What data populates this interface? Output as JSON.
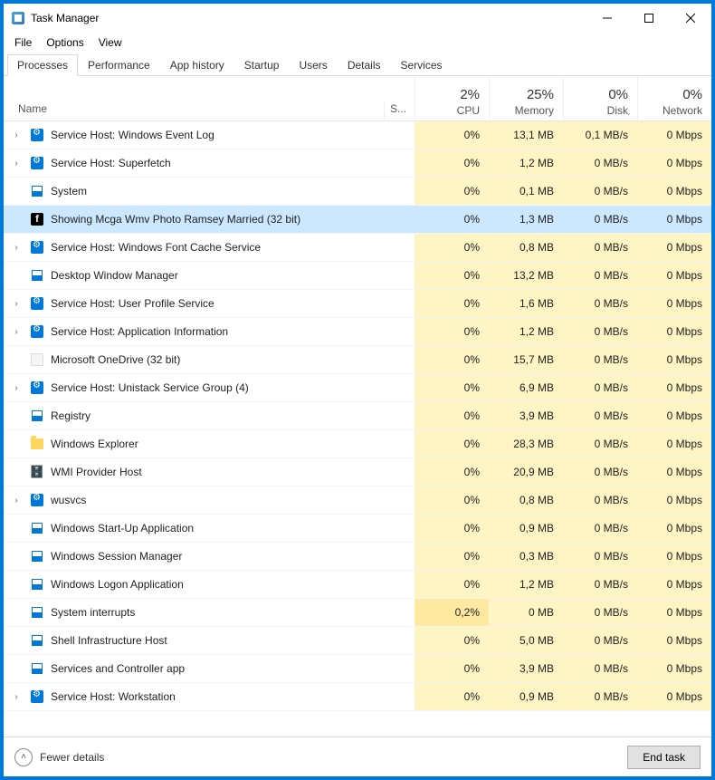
{
  "window": {
    "title": "Task Manager"
  },
  "menu": {
    "file": "File",
    "options": "Options",
    "view": "View"
  },
  "tabs": {
    "processes": "Processes",
    "performance": "Performance",
    "app_history": "App history",
    "startup": "Startup",
    "users": "Users",
    "details": "Details",
    "services": "Services"
  },
  "columns": {
    "name": "Name",
    "status": "S...",
    "cpu_pct": "2%",
    "cpu_lbl": "CPU",
    "mem_pct": "25%",
    "mem_lbl": "Memory",
    "disk_pct": "0%",
    "disk_lbl": "Disk",
    "net_pct": "0%",
    "net_lbl": "Network"
  },
  "processes": [
    {
      "expand": true,
      "icon": "gear",
      "name": "Service Host: Windows Event Log",
      "cpu": "0%",
      "mem": "13,1 MB",
      "disk": "0,1 MB/s",
      "net": "0 Mbps",
      "selected": false
    },
    {
      "expand": true,
      "icon": "gear",
      "name": "Service Host: Superfetch",
      "cpu": "0%",
      "mem": "1,2 MB",
      "disk": "0 MB/s",
      "net": "0 Mbps",
      "selected": false
    },
    {
      "expand": false,
      "icon": "sys",
      "name": "System",
      "cpu": "0%",
      "mem": "0,1 MB",
      "disk": "0 MB/s",
      "net": "0 Mbps",
      "selected": false
    },
    {
      "expand": false,
      "icon": "fb",
      "name": "Showing Mcga Wmv Photo Ramsey Married (32 bit)",
      "cpu": "0%",
      "mem": "1,3 MB",
      "disk": "0 MB/s",
      "net": "0 Mbps",
      "selected": true
    },
    {
      "expand": true,
      "icon": "gear",
      "name": "Service Host: Windows Font Cache Service",
      "cpu": "0%",
      "mem": "0,8 MB",
      "disk": "0 MB/s",
      "net": "0 Mbps",
      "selected": false
    },
    {
      "expand": false,
      "icon": "sys",
      "name": "Desktop Window Manager",
      "cpu": "0%",
      "mem": "13,2 MB",
      "disk": "0 MB/s",
      "net": "0 Mbps",
      "selected": false
    },
    {
      "expand": true,
      "icon": "gear",
      "name": "Service Host: User Profile Service",
      "cpu": "0%",
      "mem": "1,6 MB",
      "disk": "0 MB/s",
      "net": "0 Mbps",
      "selected": false
    },
    {
      "expand": true,
      "icon": "gear",
      "name": "Service Host: Application Information",
      "cpu": "0%",
      "mem": "1,2 MB",
      "disk": "0 MB/s",
      "net": "0 Mbps",
      "selected": false
    },
    {
      "expand": false,
      "icon": "blank",
      "name": "Microsoft OneDrive (32 bit)",
      "cpu": "0%",
      "mem": "15,7 MB",
      "disk": "0 MB/s",
      "net": "0 Mbps",
      "selected": false
    },
    {
      "expand": true,
      "icon": "gear",
      "name": "Service Host: Unistack Service Group (4)",
      "cpu": "0%",
      "mem": "6,9 MB",
      "disk": "0 MB/s",
      "net": "0 Mbps",
      "selected": false
    },
    {
      "expand": false,
      "icon": "sys",
      "name": "Registry",
      "cpu": "0%",
      "mem": "3,9 MB",
      "disk": "0 MB/s",
      "net": "0 Mbps",
      "selected": false
    },
    {
      "expand": false,
      "icon": "folder",
      "name": "Windows Explorer",
      "cpu": "0%",
      "mem": "28,3 MB",
      "disk": "0 MB/s",
      "net": "0 Mbps",
      "selected": false
    },
    {
      "expand": false,
      "icon": "wmi",
      "name": "WMI Provider Host",
      "cpu": "0%",
      "mem": "20,9 MB",
      "disk": "0 MB/s",
      "net": "0 Mbps",
      "selected": false
    },
    {
      "expand": true,
      "icon": "gear",
      "name": "wusvcs",
      "cpu": "0%",
      "mem": "0,8 MB",
      "disk": "0 MB/s",
      "net": "0 Mbps",
      "selected": false
    },
    {
      "expand": false,
      "icon": "sys",
      "name": "Windows Start-Up Application",
      "cpu": "0%",
      "mem": "0,9 MB",
      "disk": "0 MB/s",
      "net": "0 Mbps",
      "selected": false
    },
    {
      "expand": false,
      "icon": "sys",
      "name": "Windows Session Manager",
      "cpu": "0%",
      "mem": "0,3 MB",
      "disk": "0 MB/s",
      "net": "0 Mbps",
      "selected": false
    },
    {
      "expand": false,
      "icon": "sys",
      "name": "Windows Logon Application",
      "cpu": "0%",
      "mem": "1,2 MB",
      "disk": "0 MB/s",
      "net": "0 Mbps",
      "selected": false
    },
    {
      "expand": false,
      "icon": "sys",
      "name": "System interrupts",
      "cpu": "0,2%",
      "mem": "0 MB",
      "disk": "0 MB/s",
      "net": "0 Mbps",
      "selected": false,
      "cpu_h2": true
    },
    {
      "expand": false,
      "icon": "sys",
      "name": "Shell Infrastructure Host",
      "cpu": "0%",
      "mem": "5,0 MB",
      "disk": "0 MB/s",
      "net": "0 Mbps",
      "selected": false
    },
    {
      "expand": false,
      "icon": "sys",
      "name": "Services and Controller app",
      "cpu": "0%",
      "mem": "3,9 MB",
      "disk": "0 MB/s",
      "net": "0 Mbps",
      "selected": false
    },
    {
      "expand": true,
      "icon": "gear",
      "name": "Service Host: Workstation",
      "cpu": "0%",
      "mem": "0,9 MB",
      "disk": "0 MB/s",
      "net": "0 Mbps",
      "selected": false
    }
  ],
  "footer": {
    "fewer": "Fewer details",
    "end_task": "End task"
  }
}
